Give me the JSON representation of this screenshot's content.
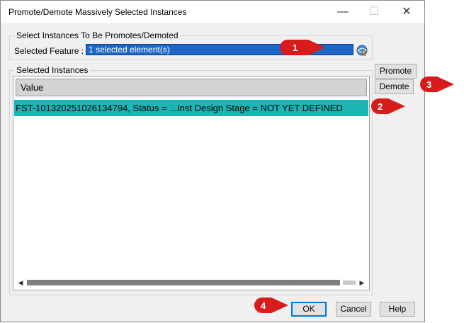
{
  "window": {
    "title": "Promote/Demote Massively Selected Instances",
    "minimize_glyph": "—",
    "maximize_glyph": "☐",
    "close_glyph": "✕"
  },
  "select_group": {
    "title": "Select Instances To Be Promotes/Demoted",
    "feature_label": "Selected Feature :",
    "feature_value": "1 selected element(s)",
    "picker_icon": "selection-icon"
  },
  "instances_group": {
    "title": "Selected Instances",
    "column_header": "Value",
    "rows": [
      {
        "value": "FST-101320251026134794,  Status = ...Inst Design Stage = NOT YET DEFINED"
      }
    ]
  },
  "side_buttons": {
    "promote": "Promote",
    "demote": "Demote"
  },
  "footer_buttons": {
    "ok": "OK",
    "cancel": "Cancel",
    "help": "Help"
  },
  "annotations": [
    {
      "number": "1",
      "color": "#d81c1c"
    },
    {
      "number": "2",
      "color": "#d81c1c"
    },
    {
      "number": "3",
      "color": "#d81c1c"
    },
    {
      "number": "4",
      "color": "#d81c1c"
    }
  ],
  "colors": {
    "selection_highlight": "#1ab5b5",
    "field_highlight": "#1f67c6"
  }
}
